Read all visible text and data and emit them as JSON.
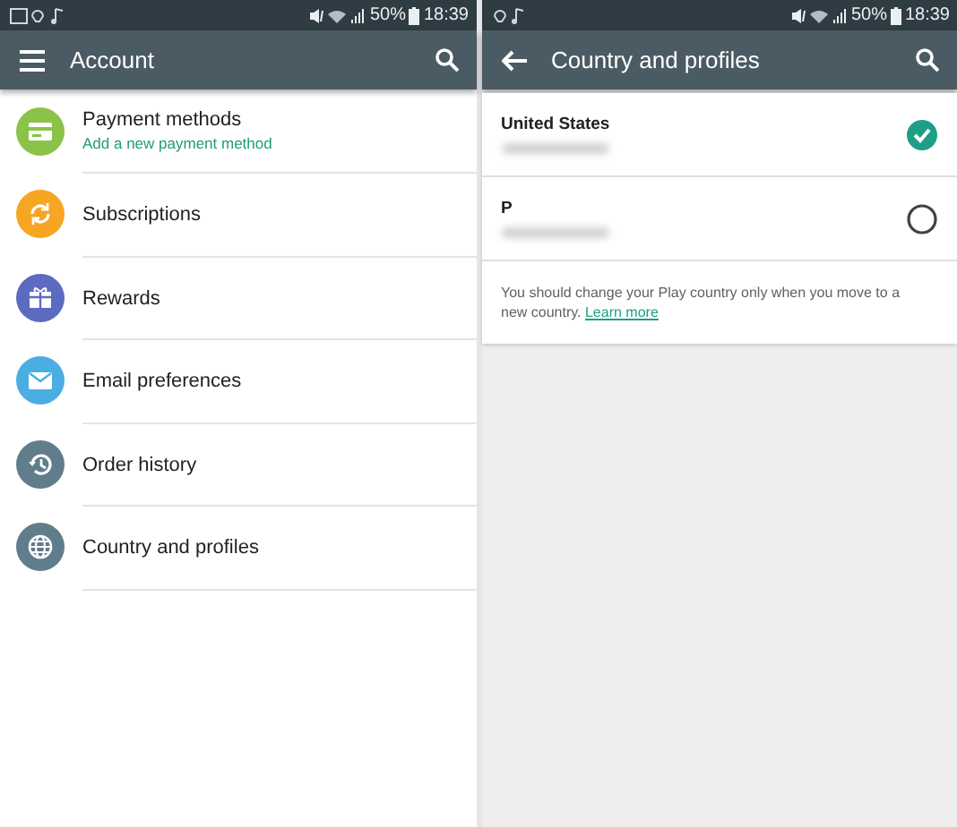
{
  "panes": [
    {
      "status_bar": {
        "battery": "50%",
        "time": "18:39"
      },
      "toolbar": {
        "title": "Account",
        "kind": "menu"
      },
      "items": [
        {
          "label": "Payment methods",
          "sublabel": "Add a new payment method",
          "kind": "card",
          "color": "#8bc34a"
        },
        {
          "label": "Subscriptions",
          "kind": "refresh",
          "color": "#f6a623"
        },
        {
          "label": "Rewards",
          "kind": "gift",
          "color": "#5c6bc0"
        },
        {
          "label": "Email preferences",
          "kind": "mail",
          "color": "#4aaee3"
        },
        {
          "label": "Order history",
          "kind": "history",
          "color": "#607d8b"
        },
        {
          "label": "Country and profiles",
          "kind": "globe",
          "color": "#607d8b"
        }
      ]
    },
    {
      "status_bar": {
        "battery": "50%",
        "time": "18:39"
      },
      "toolbar": {
        "title": "Country and profiles",
        "kind": "back"
      },
      "countries": [
        {
          "label": "United States",
          "selected": true
        },
        {
          "label": "P",
          "selected": false
        }
      ],
      "note": {
        "text": "You should change your Play country only when you move to a new country.",
        "link": "Learn more"
      }
    }
  ]
}
